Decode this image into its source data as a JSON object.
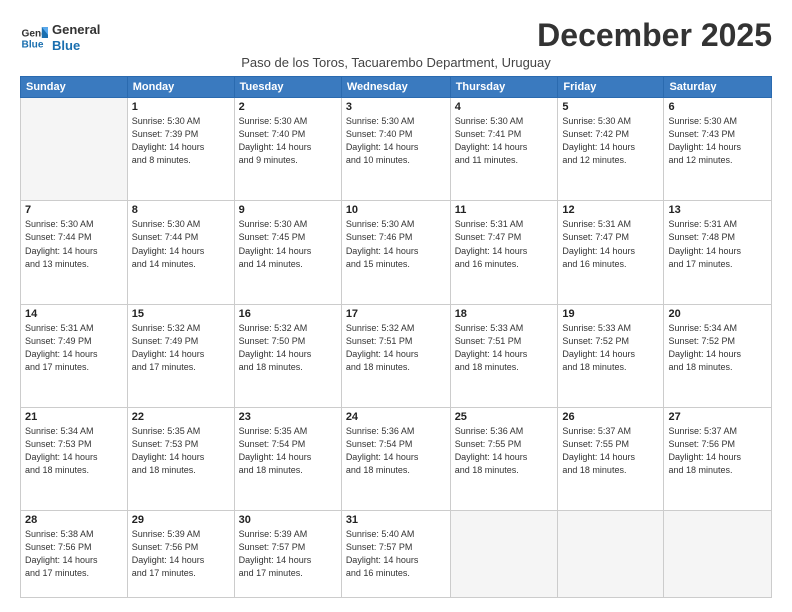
{
  "logo": {
    "line1": "General",
    "line2": "Blue"
  },
  "title": "December 2025",
  "subtitle": "Paso de los Toros, Tacuarembo Department, Uruguay",
  "days_header": [
    "Sunday",
    "Monday",
    "Tuesday",
    "Wednesday",
    "Thursday",
    "Friday",
    "Saturday"
  ],
  "weeks": [
    [
      {
        "day": "",
        "detail": ""
      },
      {
        "day": "1",
        "detail": "Sunrise: 5:30 AM\nSunset: 7:39 PM\nDaylight: 14 hours\nand 8 minutes."
      },
      {
        "day": "2",
        "detail": "Sunrise: 5:30 AM\nSunset: 7:40 PM\nDaylight: 14 hours\nand 9 minutes."
      },
      {
        "day": "3",
        "detail": "Sunrise: 5:30 AM\nSunset: 7:40 PM\nDaylight: 14 hours\nand 10 minutes."
      },
      {
        "day": "4",
        "detail": "Sunrise: 5:30 AM\nSunset: 7:41 PM\nDaylight: 14 hours\nand 11 minutes."
      },
      {
        "day": "5",
        "detail": "Sunrise: 5:30 AM\nSunset: 7:42 PM\nDaylight: 14 hours\nand 12 minutes."
      },
      {
        "day": "6",
        "detail": "Sunrise: 5:30 AM\nSunset: 7:43 PM\nDaylight: 14 hours\nand 12 minutes."
      }
    ],
    [
      {
        "day": "7",
        "detail": "Sunrise: 5:30 AM\nSunset: 7:44 PM\nDaylight: 14 hours\nand 13 minutes."
      },
      {
        "day": "8",
        "detail": "Sunrise: 5:30 AM\nSunset: 7:44 PM\nDaylight: 14 hours\nand 14 minutes."
      },
      {
        "day": "9",
        "detail": "Sunrise: 5:30 AM\nSunset: 7:45 PM\nDaylight: 14 hours\nand 14 minutes."
      },
      {
        "day": "10",
        "detail": "Sunrise: 5:30 AM\nSunset: 7:46 PM\nDaylight: 14 hours\nand 15 minutes."
      },
      {
        "day": "11",
        "detail": "Sunrise: 5:31 AM\nSunset: 7:47 PM\nDaylight: 14 hours\nand 16 minutes."
      },
      {
        "day": "12",
        "detail": "Sunrise: 5:31 AM\nSunset: 7:47 PM\nDaylight: 14 hours\nand 16 minutes."
      },
      {
        "day": "13",
        "detail": "Sunrise: 5:31 AM\nSunset: 7:48 PM\nDaylight: 14 hours\nand 17 minutes."
      }
    ],
    [
      {
        "day": "14",
        "detail": "Sunrise: 5:31 AM\nSunset: 7:49 PM\nDaylight: 14 hours\nand 17 minutes."
      },
      {
        "day": "15",
        "detail": "Sunrise: 5:32 AM\nSunset: 7:49 PM\nDaylight: 14 hours\nand 17 minutes."
      },
      {
        "day": "16",
        "detail": "Sunrise: 5:32 AM\nSunset: 7:50 PM\nDaylight: 14 hours\nand 18 minutes."
      },
      {
        "day": "17",
        "detail": "Sunrise: 5:32 AM\nSunset: 7:51 PM\nDaylight: 14 hours\nand 18 minutes."
      },
      {
        "day": "18",
        "detail": "Sunrise: 5:33 AM\nSunset: 7:51 PM\nDaylight: 14 hours\nand 18 minutes."
      },
      {
        "day": "19",
        "detail": "Sunrise: 5:33 AM\nSunset: 7:52 PM\nDaylight: 14 hours\nand 18 minutes."
      },
      {
        "day": "20",
        "detail": "Sunrise: 5:34 AM\nSunset: 7:52 PM\nDaylight: 14 hours\nand 18 minutes."
      }
    ],
    [
      {
        "day": "21",
        "detail": "Sunrise: 5:34 AM\nSunset: 7:53 PM\nDaylight: 14 hours\nand 18 minutes."
      },
      {
        "day": "22",
        "detail": "Sunrise: 5:35 AM\nSunset: 7:53 PM\nDaylight: 14 hours\nand 18 minutes."
      },
      {
        "day": "23",
        "detail": "Sunrise: 5:35 AM\nSunset: 7:54 PM\nDaylight: 14 hours\nand 18 minutes."
      },
      {
        "day": "24",
        "detail": "Sunrise: 5:36 AM\nSunset: 7:54 PM\nDaylight: 14 hours\nand 18 minutes."
      },
      {
        "day": "25",
        "detail": "Sunrise: 5:36 AM\nSunset: 7:55 PM\nDaylight: 14 hours\nand 18 minutes."
      },
      {
        "day": "26",
        "detail": "Sunrise: 5:37 AM\nSunset: 7:55 PM\nDaylight: 14 hours\nand 18 minutes."
      },
      {
        "day": "27",
        "detail": "Sunrise: 5:37 AM\nSunset: 7:56 PM\nDaylight: 14 hours\nand 18 minutes."
      }
    ],
    [
      {
        "day": "28",
        "detail": "Sunrise: 5:38 AM\nSunset: 7:56 PM\nDaylight: 14 hours\nand 17 minutes."
      },
      {
        "day": "29",
        "detail": "Sunrise: 5:39 AM\nSunset: 7:56 PM\nDaylight: 14 hours\nand 17 minutes."
      },
      {
        "day": "30",
        "detail": "Sunrise: 5:39 AM\nSunset: 7:57 PM\nDaylight: 14 hours\nand 17 minutes."
      },
      {
        "day": "31",
        "detail": "Sunrise: 5:40 AM\nSunset: 7:57 PM\nDaylight: 14 hours\nand 16 minutes."
      },
      {
        "day": "",
        "detail": ""
      },
      {
        "day": "",
        "detail": ""
      },
      {
        "day": "",
        "detail": ""
      }
    ]
  ]
}
